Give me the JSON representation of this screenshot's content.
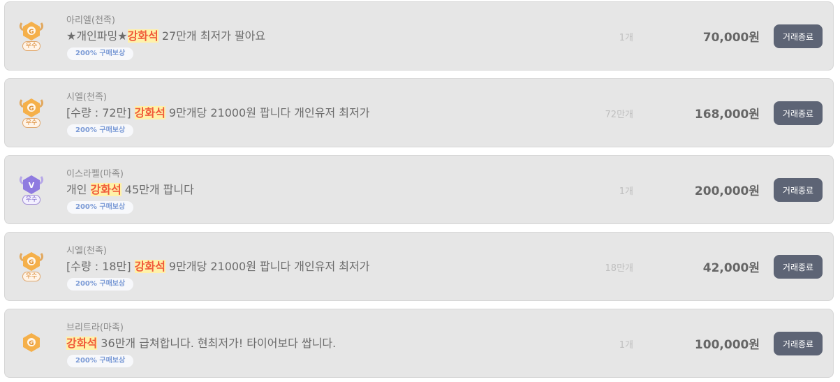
{
  "listings": [
    {
      "badge": "gold",
      "badge_label": "우수",
      "icon_letter": "G",
      "seller": "아리엘(천족)",
      "title_pre": "★개인파밍★",
      "title_hl": "강화석",
      "title_post": " 27만개 최저가 팔아요",
      "reward": "200% 구매보상",
      "qty": "1개",
      "price": "70,000원",
      "action": "거래종료"
    },
    {
      "badge": "gold",
      "badge_label": "우수",
      "icon_letter": "G",
      "seller": "시엘(천족)",
      "title_pre": "[수량 : 72만] ",
      "title_hl": "강화석",
      "title_post": " 9만개당 21000원 팝니다 개인유저 최저가",
      "reward": "200% 구매보상",
      "qty": "72만개",
      "price": "168,000원",
      "action": "거래종료"
    },
    {
      "badge": "purple",
      "badge_label": "우수",
      "icon_letter": "V",
      "seller": "이스라펠(마족)",
      "title_pre": "개인 ",
      "title_hl": "강화석",
      "title_post": " 45만개 팝니다",
      "reward": "200% 구매보상",
      "qty": "1개",
      "price": "200,000원",
      "action": "거래종료"
    },
    {
      "badge": "gold",
      "badge_label": "우수",
      "icon_letter": "G",
      "seller": "시엘(천족)",
      "title_pre": "[수량 : 18만] ",
      "title_hl": "강화석",
      "title_post": " 9만개당 21000원 팝니다 개인유저 최저가",
      "reward": "200% 구매보상",
      "qty": "18만개",
      "price": "42,000원",
      "action": "거래종료"
    },
    {
      "badge": "gold-plain",
      "badge_label": "",
      "icon_letter": "G",
      "seller": "브리트라(마족)",
      "title_pre": "",
      "title_hl": "강화석",
      "title_post": " 36만개 급쳐합니다. 현최저가! 타이어보다 쌉니다.",
      "reward": "200% 구매보상",
      "qty": "1개",
      "price": "100,000원",
      "action": "거래종료"
    }
  ],
  "colors": {
    "gold_badge": "#f5b04a",
    "purple_badge": "#8f7be0",
    "highlight_text": "#f05a3a",
    "highlight_bg": "#fff1a8",
    "button_bg": "#5d6475"
  }
}
